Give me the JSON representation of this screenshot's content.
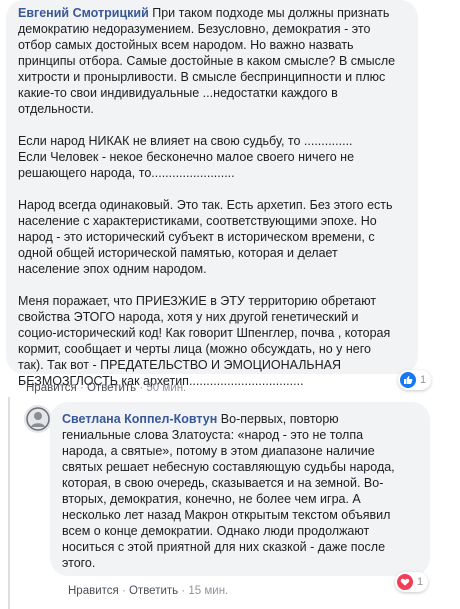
{
  "comments": [
    {
      "author": "Евгений Смотрицкий",
      "text": " При таком подходе мы должны признать\nдемократию недоразумением. Безусловно, демократия - это\nотбор самых достойных всем народом. Но важно назвать\nпринципы отбора. Самые достойные в каком смысле? В смысле\nхитрости и пронырливости. В смысле беспринципности и плюс\nкакие-то свои индивидуальные ...недостатки каждого в\nотдельности.\n\nЕсли народ НИКАК не влияет на свою судьбу, то ..............\nЕсли Человек - некое бесконечно малое своего ничего не\nрешающего народа, то........................\n\nНарод всегда одинаковый. Это так. Есть архетип. Без этого есть\nнаселение с характеристиками, соответствующими эпохе. Но\nнарод - это исторический субъект в историческом времени, с\nодной общей исторической памятью, которая и делает\nнаселение эпох одним народом.\n\nМеня поражает, что ПРИЕЗЖИЕ в ЭТУ территорию обретают\nсвойства ЭТОГО народа, хотя у них другой генетический и\nсоцио-исторический код! Как говорит Шпенглер, почва , которая\nкормит, сообщает и черты лица (можно обсуждать, но у него\nтак). Так вот - ПРЕДАТЕЛЬСТВО И ЭМОЦИОНАЛЬНАЯ\nБЕЗМОЗГЛОСТЬ как архетип.................................",
      "like_label": "Нравится",
      "reply_label": "Ответить",
      "time": "50 мин.",
      "reaction_count": "1",
      "reaction_icon": "like-icon"
    },
    {
      "author": "Светлана Коппел-Ковтун",
      "text": " Во-первых, повторю\nгениальные слова Златоуста: «народ - это не толпа\nнарода, а святые», потому в этом диапазоне наличие\nсвятых решает небесную составляющую судьбы народа,\nкоторая, в свою очередь, сказывается и на земной. Во-\nвторых, демократия, конечно, не более чем игра. А\nнесколько лет назад Макрон открытым текстом объявил\nвсем о конце демократии. Однако люди продолжают\nноситься с этой приятной для них сказкой - даже после\nэтого.",
      "like_label": "Нравится",
      "reply_label": "Ответить",
      "time": "15 мин.",
      "reaction_count": "1",
      "reaction_icon": "love-icon"
    }
  ],
  "separator": " · ",
  "colors": {
    "author": "#385898",
    "bubble": "#f2f3f5",
    "like": "#1877f2",
    "love": "#f33e58"
  }
}
